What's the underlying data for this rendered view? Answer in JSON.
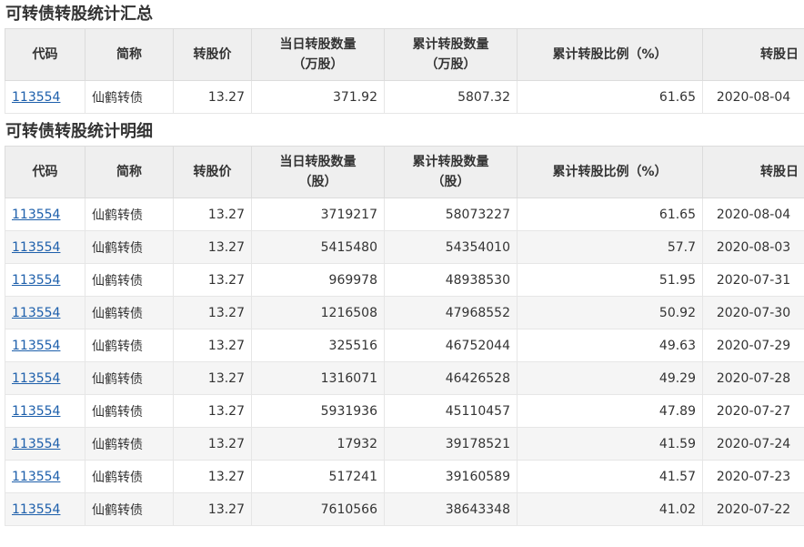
{
  "summary": {
    "title": "可转债转股统计汇总",
    "headers": {
      "code": "代码",
      "name": "简称",
      "price": "转股价",
      "daily_line1": "当日转股数量",
      "daily_line2": "（万股）",
      "cum_line1": "累计转股数量",
      "cum_line2": "（万股）",
      "ratio": "累计转股比例（%）",
      "date": "转股日"
    },
    "rows": [
      {
        "code": "113554",
        "name": "仙鹤转债",
        "price": "13.27",
        "daily": "371.92",
        "cum": "5807.32",
        "ratio": "61.65",
        "date": "2020-08-04"
      }
    ]
  },
  "detail": {
    "title": "可转债转股统计明细",
    "headers": {
      "code": "代码",
      "name": "简称",
      "price": "转股价",
      "daily_line1": "当日转股数量",
      "daily_line2": "（股）",
      "cum_line1": "累计转股数量",
      "cum_line2": "（股）",
      "ratio": "累计转股比例（%）",
      "date": "转股日"
    },
    "rows": [
      {
        "code": "113554",
        "name": "仙鹤转债",
        "price": "13.27",
        "daily": "3719217",
        "cum": "58073227",
        "ratio": "61.65",
        "date": "2020-08-04"
      },
      {
        "code": "113554",
        "name": "仙鹤转债",
        "price": "13.27",
        "daily": "5415480",
        "cum": "54354010",
        "ratio": "57.7",
        "date": "2020-08-03"
      },
      {
        "code": "113554",
        "name": "仙鹤转债",
        "price": "13.27",
        "daily": "969978",
        "cum": "48938530",
        "ratio": "51.95",
        "date": "2020-07-31"
      },
      {
        "code": "113554",
        "name": "仙鹤转债",
        "price": "13.27",
        "daily": "1216508",
        "cum": "47968552",
        "ratio": "50.92",
        "date": "2020-07-30"
      },
      {
        "code": "113554",
        "name": "仙鹤转债",
        "price": "13.27",
        "daily": "325516",
        "cum": "46752044",
        "ratio": "49.63",
        "date": "2020-07-29"
      },
      {
        "code": "113554",
        "name": "仙鹤转债",
        "price": "13.27",
        "daily": "1316071",
        "cum": "46426528",
        "ratio": "49.29",
        "date": "2020-07-28"
      },
      {
        "code": "113554",
        "name": "仙鹤转债",
        "price": "13.27",
        "daily": "5931936",
        "cum": "45110457",
        "ratio": "47.89",
        "date": "2020-07-27"
      },
      {
        "code": "113554",
        "name": "仙鹤转债",
        "price": "13.27",
        "daily": "17932",
        "cum": "39178521",
        "ratio": "41.59",
        "date": "2020-07-24"
      },
      {
        "code": "113554",
        "name": "仙鹤转债",
        "price": "13.27",
        "daily": "517241",
        "cum": "39160589",
        "ratio": "41.57",
        "date": "2020-07-23"
      },
      {
        "code": "113554",
        "name": "仙鹤转债",
        "price": "13.27",
        "daily": "7610566",
        "cum": "38643348",
        "ratio": "41.02",
        "date": "2020-07-22"
      }
    ]
  }
}
